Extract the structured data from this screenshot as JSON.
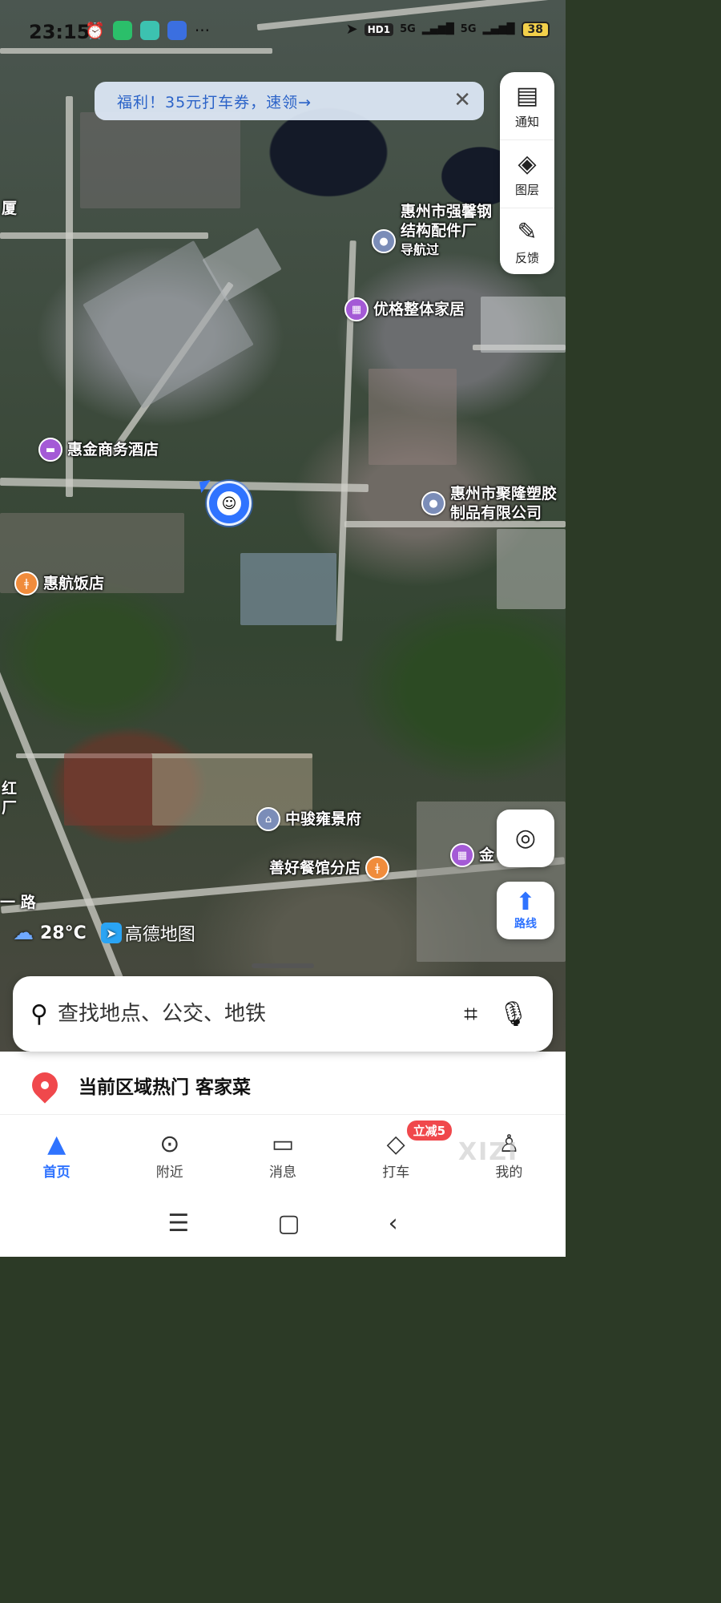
{
  "status_bar": {
    "time": "23:15",
    "network": "HD1",
    "signal1": "5G",
    "signal2": "5G",
    "battery": "38"
  },
  "promo": {
    "text": "福利！35元打车券，速领→",
    "close_icon": "close-icon"
  },
  "side_toolbar": [
    {
      "label": "通知",
      "icon": "notification-icon"
    },
    {
      "label": "图层",
      "icon": "layers-icon"
    },
    {
      "label": "反馈",
      "icon": "feedback-edit-icon"
    }
  ],
  "map": {
    "pois": [
      {
        "name": "惠州市强馨钢\n结构配件厂",
        "sub": "导航过",
        "type": "place"
      },
      {
        "name": "优格整体家居",
        "type": "shop"
      },
      {
        "name": "惠金商务酒店",
        "type": "hotel"
      },
      {
        "name": "惠州市聚隆塑胶\n制品有限公司",
        "type": "place"
      },
      {
        "name": "惠航饭店",
        "type": "restaurant"
      },
      {
        "name": "中骏雍景府",
        "type": "residence"
      },
      {
        "name": "善好餐馆分店",
        "type": "restaurant"
      },
      {
        "name": "金",
        "type": "shop"
      }
    ],
    "edge_labels": {
      "left_top": "厦",
      "left_mid": "红\n厂",
      "left_road": "一 路"
    },
    "weather": {
      "temp": "28°C",
      "icon": "cloud-icon"
    },
    "brand": "高德地图"
  },
  "fabs": {
    "locate_icon": "locate-icon",
    "route_label": "路线"
  },
  "search": {
    "placeholder": "查找地点、公交、地铁"
  },
  "hot_topic": {
    "text": "当前区域热门 客家菜"
  },
  "tabs": [
    {
      "label": "首页",
      "icon": "home-nav-icon",
      "active": true
    },
    {
      "label": "附近",
      "icon": "nearby-pin-icon"
    },
    {
      "label": "消息",
      "icon": "message-icon"
    },
    {
      "label": "打车",
      "icon": "taxi-icon",
      "badge": "立减5"
    },
    {
      "label": "我的",
      "icon": "profile-icon"
    }
  ],
  "watermark": "XIZI",
  "colors": {
    "accent": "#2f73ff",
    "promo_text": "#2b63c8",
    "badge": "#f0484c"
  }
}
